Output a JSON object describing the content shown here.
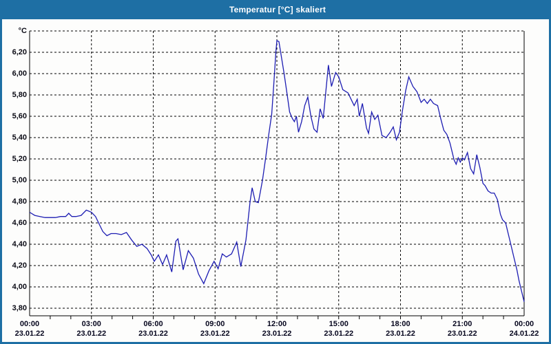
{
  "window": {
    "title": "Temperatur [°C] skaliert",
    "titlebar_color": "#1e6fa4",
    "border_color": "#1e6fa4",
    "background": "#fdfdfc"
  },
  "chart_data": {
    "type": "line",
    "title": "Temperatur [°C] skaliert",
    "y_unit": "°C",
    "xlabel": "",
    "ylabel": "°C",
    "ylim": [
      3.73,
      6.4
    ],
    "xlim_hours": [
      0,
      24
    ],
    "grid": "dashed",
    "grid_color": "#000000",
    "frame_color": "#000000",
    "line_color": "#1c1cb2",
    "legend": "none",
    "y_ticks": [
      {
        "v": 3.8,
        "label": "3,80"
      },
      {
        "v": 4.0,
        "label": "4,00"
      },
      {
        "v": 4.2,
        "label": "4,20"
      },
      {
        "v": 4.4,
        "label": "4,40"
      },
      {
        "v": 4.6,
        "label": "4,60"
      },
      {
        "v": 4.8,
        "label": "4,80"
      },
      {
        "v": 5.0,
        "label": "5,00"
      },
      {
        "v": 5.2,
        "label": "5,20"
      },
      {
        "v": 5.4,
        "label": "5,40"
      },
      {
        "v": 5.6,
        "label": "5,60"
      },
      {
        "v": 5.8,
        "label": "5,80"
      },
      {
        "v": 6.0,
        "label": "6,00"
      },
      {
        "v": 6.2,
        "label": "6,20"
      },
      {
        "v": 6.4,
        "label": "°C",
        "is_unit": true
      }
    ],
    "x_ticks": [
      {
        "t": 0,
        "time": "00:00",
        "date": "23.01.22"
      },
      {
        "t": 3,
        "time": "03:00",
        "date": "23.01.22"
      },
      {
        "t": 6,
        "time": "06:00",
        "date": "23.01.22"
      },
      {
        "t": 9,
        "time": "09:00",
        "date": "23.01.22"
      },
      {
        "t": 12,
        "time": "12:00",
        "date": "23.01.22"
      },
      {
        "t": 15,
        "time": "15:00",
        "date": "23.01.22"
      },
      {
        "t": 18,
        "time": "18:00",
        "date": "23.01.22"
      },
      {
        "t": 21,
        "time": "21:00",
        "date": "23.01.22"
      },
      {
        "t": 24,
        "time": "00:00",
        "date": "24.01.22"
      }
    ],
    "minor_tick_every_hours": 1,
    "series": [
      {
        "name": "Temperatur",
        "points": [
          [
            0.0,
            4.7
          ],
          [
            0.25,
            4.67
          ],
          [
            0.5,
            4.66
          ],
          [
            0.75,
            4.65
          ],
          [
            1.0,
            4.65
          ],
          [
            1.25,
            4.65
          ],
          [
            1.5,
            4.66
          ],
          [
            1.75,
            4.66
          ],
          [
            1.9,
            4.69
          ],
          [
            2.05,
            4.66
          ],
          [
            2.25,
            4.66
          ],
          [
            2.5,
            4.67
          ],
          [
            2.75,
            4.72
          ],
          [
            3.0,
            4.7
          ],
          [
            3.2,
            4.66
          ],
          [
            3.4,
            4.58
          ],
          [
            3.55,
            4.52
          ],
          [
            3.75,
            4.48
          ],
          [
            3.95,
            4.5
          ],
          [
            4.2,
            4.5
          ],
          [
            4.45,
            4.49
          ],
          [
            4.7,
            4.51
          ],
          [
            4.95,
            4.44
          ],
          [
            5.2,
            4.38
          ],
          [
            5.45,
            4.4
          ],
          [
            5.7,
            4.36
          ],
          [
            5.9,
            4.3
          ],
          [
            6.05,
            4.24
          ],
          [
            6.25,
            4.3
          ],
          [
            6.45,
            4.21
          ],
          [
            6.65,
            4.3
          ],
          [
            6.9,
            4.14
          ],
          [
            7.1,
            4.43
          ],
          [
            7.2,
            4.45
          ],
          [
            7.45,
            4.16
          ],
          [
            7.7,
            4.34
          ],
          [
            7.95,
            4.27
          ],
          [
            8.2,
            4.12
          ],
          [
            8.45,
            4.03
          ],
          [
            8.7,
            4.15
          ],
          [
            8.95,
            4.24
          ],
          [
            9.15,
            4.17
          ],
          [
            9.35,
            4.31
          ],
          [
            9.55,
            4.28
          ],
          [
            9.8,
            4.31
          ],
          [
            10.05,
            4.42
          ],
          [
            10.25,
            4.19
          ],
          [
            10.5,
            4.44
          ],
          [
            10.7,
            4.8
          ],
          [
            10.8,
            4.93
          ],
          [
            10.95,
            4.8
          ],
          [
            11.1,
            4.79
          ],
          [
            11.3,
            5.0
          ],
          [
            11.45,
            5.2
          ],
          [
            11.6,
            5.42
          ],
          [
            11.75,
            5.62
          ],
          [
            11.85,
            5.9
          ],
          [
            11.95,
            6.2
          ],
          [
            12.0,
            6.31
          ],
          [
            12.1,
            6.3
          ],
          [
            12.2,
            6.18
          ],
          [
            12.35,
            6.0
          ],
          [
            12.5,
            5.8
          ],
          [
            12.62,
            5.64
          ],
          [
            12.75,
            5.58
          ],
          [
            12.85,
            5.55
          ],
          [
            12.95,
            5.6
          ],
          [
            13.05,
            5.45
          ],
          [
            13.2,
            5.55
          ],
          [
            13.35,
            5.7
          ],
          [
            13.5,
            5.78
          ],
          [
            13.65,
            5.6
          ],
          [
            13.8,
            5.48
          ],
          [
            13.95,
            5.45
          ],
          [
            14.1,
            5.67
          ],
          [
            14.25,
            5.58
          ],
          [
            14.5,
            6.08
          ],
          [
            14.65,
            5.88
          ],
          [
            14.85,
            6.01
          ],
          [
            15.0,
            5.97
          ],
          [
            15.2,
            5.85
          ],
          [
            15.45,
            5.82
          ],
          [
            15.6,
            5.76
          ],
          [
            15.75,
            5.7
          ],
          [
            15.9,
            5.76
          ],
          [
            16.0,
            5.6
          ],
          [
            16.15,
            5.72
          ],
          [
            16.35,
            5.49
          ],
          [
            16.45,
            5.44
          ],
          [
            16.6,
            5.64
          ],
          [
            16.75,
            5.57
          ],
          [
            16.9,
            5.61
          ],
          [
            17.1,
            5.42
          ],
          [
            17.3,
            5.4
          ],
          [
            17.5,
            5.45
          ],
          [
            17.65,
            5.5
          ],
          [
            17.8,
            5.38
          ],
          [
            17.95,
            5.45
          ],
          [
            18.1,
            5.66
          ],
          [
            18.25,
            5.84
          ],
          [
            18.4,
            5.97
          ],
          [
            18.6,
            5.88
          ],
          [
            18.8,
            5.83
          ],
          [
            19.0,
            5.73
          ],
          [
            19.15,
            5.76
          ],
          [
            19.3,
            5.72
          ],
          [
            19.45,
            5.76
          ],
          [
            19.6,
            5.72
          ],
          [
            19.8,
            5.7
          ],
          [
            19.95,
            5.58
          ],
          [
            20.1,
            5.47
          ],
          [
            20.25,
            5.43
          ],
          [
            20.4,
            5.35
          ],
          [
            20.5,
            5.27
          ],
          [
            20.6,
            5.19
          ],
          [
            20.7,
            5.15
          ],
          [
            20.8,
            5.21
          ],
          [
            20.9,
            5.17
          ],
          [
            21.0,
            5.21
          ],
          [
            21.1,
            5.19
          ],
          [
            21.25,
            5.26
          ],
          [
            21.4,
            5.11
          ],
          [
            21.55,
            5.06
          ],
          [
            21.7,
            5.24
          ],
          [
            21.85,
            5.12
          ],
          [
            22.0,
            4.97
          ],
          [
            22.1,
            4.95
          ],
          [
            22.25,
            4.9
          ],
          [
            22.4,
            4.88
          ],
          [
            22.55,
            4.88
          ],
          [
            22.7,
            4.82
          ],
          [
            22.85,
            4.68
          ],
          [
            22.95,
            4.63
          ],
          [
            23.1,
            4.6
          ],
          [
            23.2,
            4.52
          ],
          [
            23.35,
            4.4
          ],
          [
            23.5,
            4.28
          ],
          [
            23.65,
            4.16
          ],
          [
            23.75,
            4.06
          ],
          [
            23.85,
            3.98
          ],
          [
            24.0,
            3.86
          ]
        ]
      }
    ]
  }
}
